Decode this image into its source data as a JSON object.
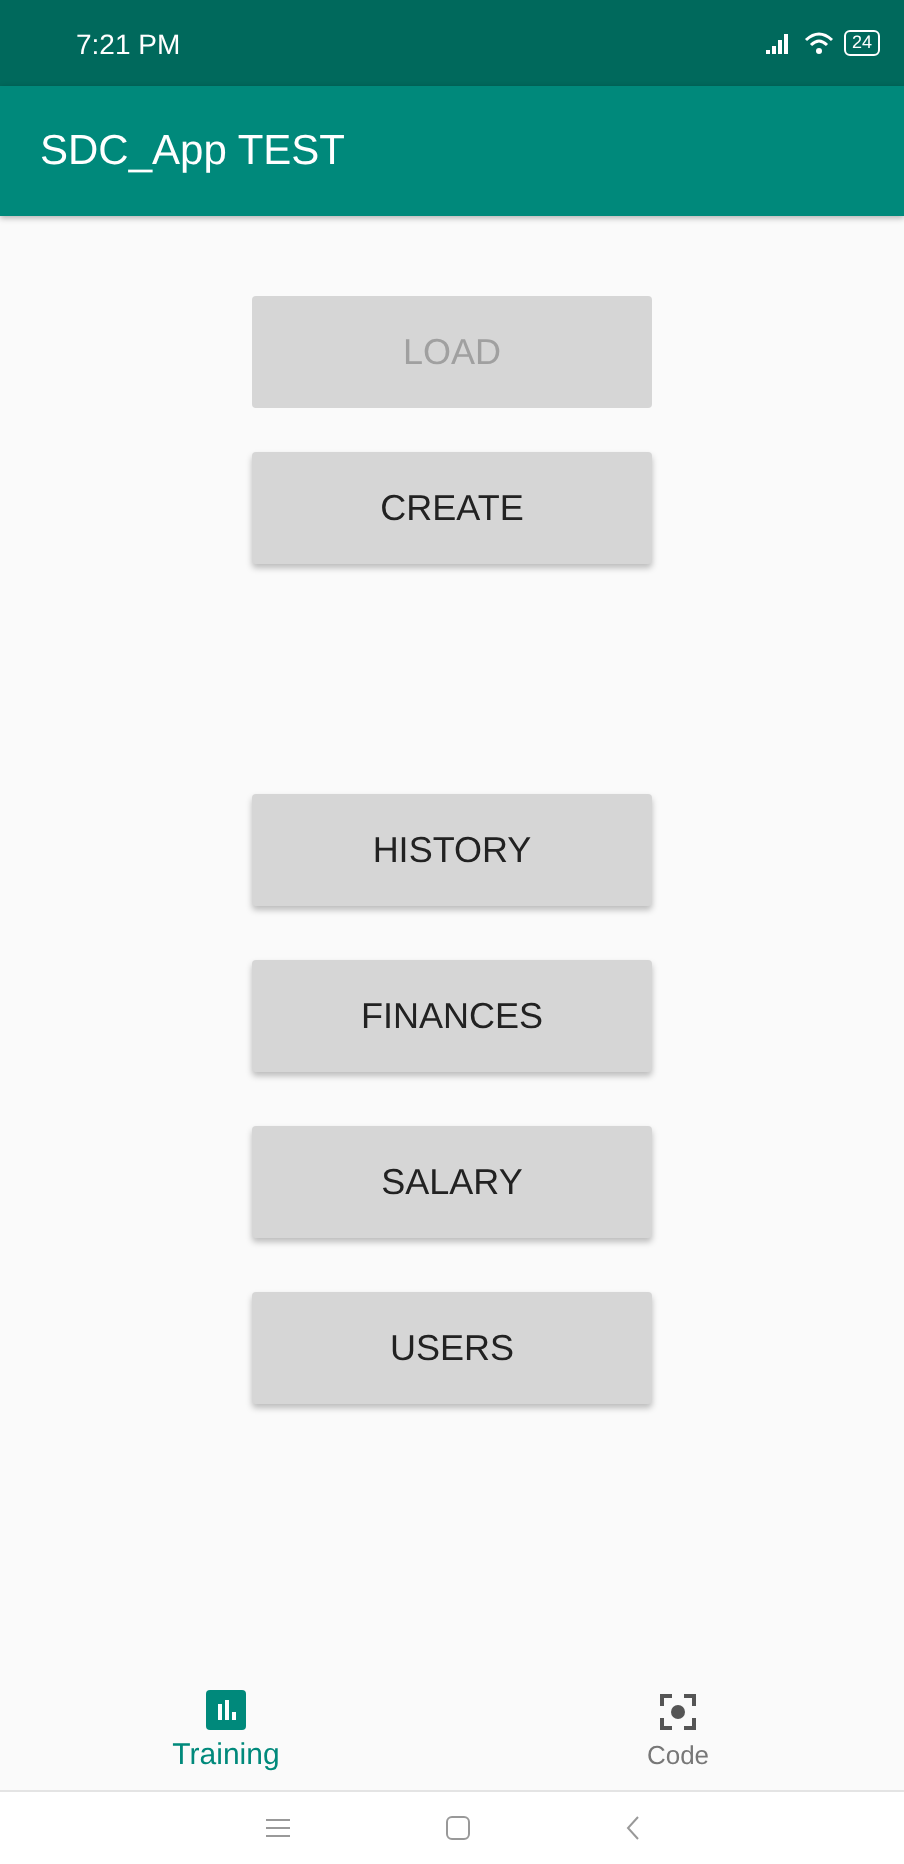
{
  "status_bar": {
    "time": "7:21 PM",
    "battery": "24"
  },
  "app_bar": {
    "title": "SDC_App TEST"
  },
  "button_groups": [
    [
      {
        "label": "LOAD",
        "disabled": true
      },
      {
        "label": "CREATE",
        "disabled": false
      }
    ],
    [
      {
        "label": "HISTORY",
        "disabled": false
      },
      {
        "label": "FINANCES",
        "disabled": false
      },
      {
        "label": "SALARY",
        "disabled": false
      },
      {
        "label": "USERS",
        "disabled": false
      }
    ]
  ],
  "bottom_nav": [
    {
      "label": "Training",
      "kind": "chart",
      "selected": true
    },
    {
      "label": "Code",
      "kind": "scan",
      "selected": false
    }
  ]
}
